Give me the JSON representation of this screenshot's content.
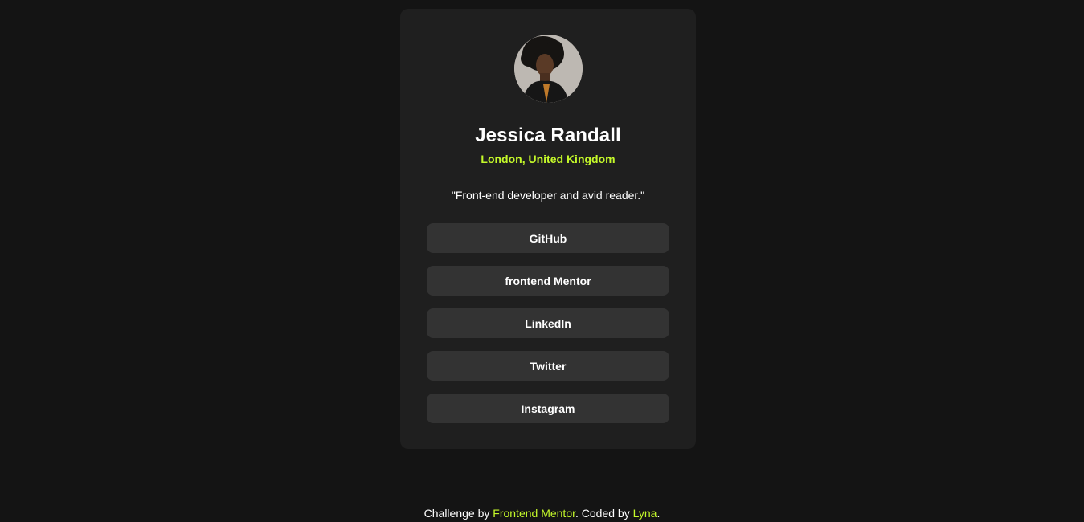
{
  "profile": {
    "avatar_alt": "Jessica Randall",
    "name": "Jessica Randall",
    "location": "London, United Kingdom",
    "bio": "\"Front-end developer and avid reader.\""
  },
  "links": [
    {
      "label": "GitHub"
    },
    {
      "label": "frontend Mentor"
    },
    {
      "label": "LinkedIn"
    },
    {
      "label": "Twitter"
    },
    {
      "label": "Instagram"
    }
  ],
  "footer": {
    "prefix": "Challenge by ",
    "challenge_link": "Frontend Mentor",
    "middle": ". Coded by ",
    "author_link": "Lyna",
    "suffix": "."
  },
  "colors": {
    "background": "#141414",
    "card": "#1f1f1f",
    "button": "#333333",
    "accent": "#c4f82a",
    "text": "#ffffff"
  }
}
